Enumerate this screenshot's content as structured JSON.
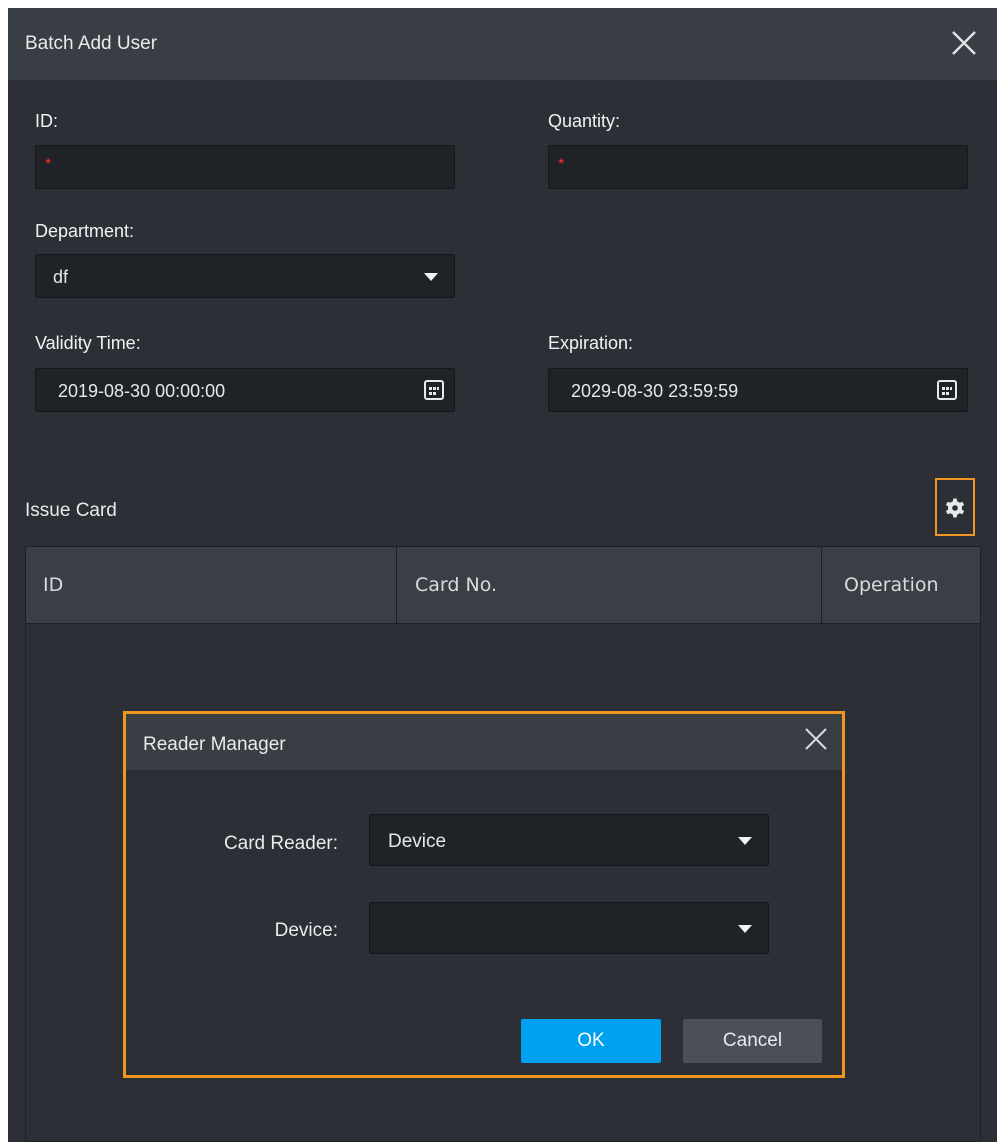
{
  "dialog": {
    "title": "Batch Add User",
    "close_icon": "close-icon"
  },
  "form": {
    "id_label": "ID:",
    "id_value": "",
    "quantity_label": "Quantity:",
    "quantity_value": "",
    "required_marker": "*",
    "department_label": "Department:",
    "department_value": "df",
    "validity_label": "Validity Time:",
    "validity_value": "2019-08-30 00:00:00",
    "expiration_label": "Expiration:",
    "expiration_value": "2029-08-30 23:59:59"
  },
  "issue_card": {
    "title": "Issue Card",
    "settings_icon": "gear-icon",
    "columns": [
      "ID",
      "Card No.",
      "Operation"
    ]
  },
  "reader_manager": {
    "title": "Reader Manager",
    "card_reader_label": "Card Reader:",
    "card_reader_value": "Device",
    "device_label": "Device:",
    "device_value": "",
    "ok_label": "OK",
    "cancel_label": "Cancel"
  },
  "colors": {
    "highlight": "#f0961e",
    "primary_button": "#00a0f0",
    "required": "#ff2a2a",
    "dialog_bg": "#2c3036"
  }
}
